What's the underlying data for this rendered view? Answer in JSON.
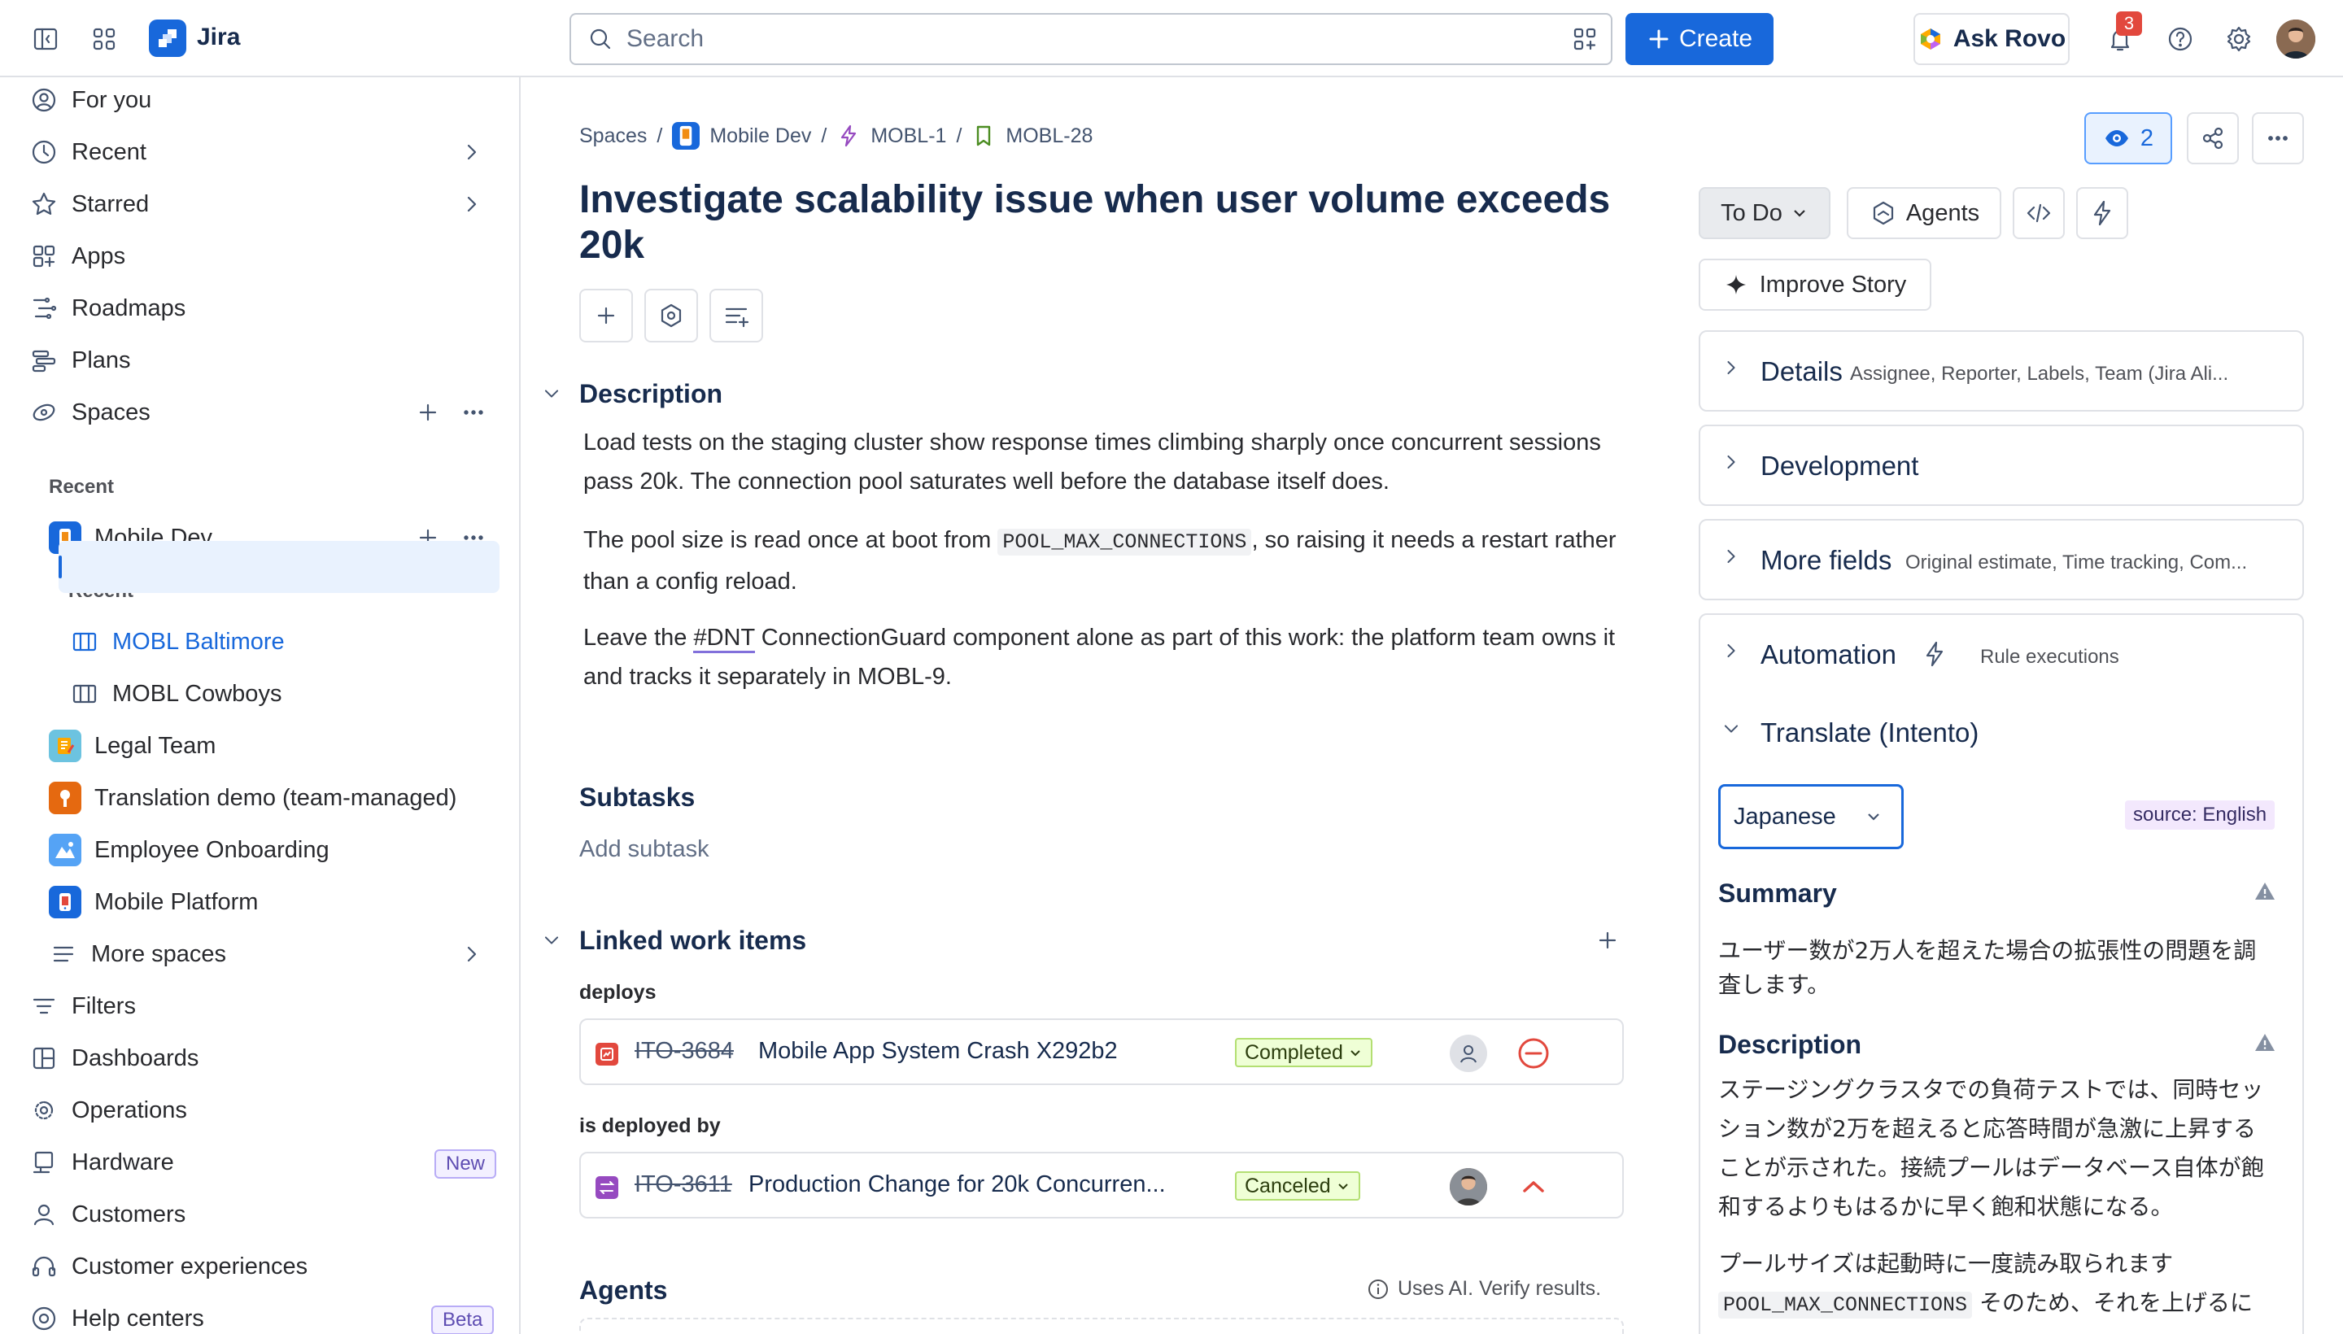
{
  "topbar": {
    "app_name": "Jira",
    "search_placeholder": "Search",
    "create_label": "Create",
    "ask_rovo_label": "Ask Rovo",
    "notification_count": "3"
  },
  "sidebar": {
    "for_you": "For you",
    "recent": "Recent",
    "starred": "Starred",
    "apps": "Apps",
    "roadmaps": "Roadmaps",
    "plans": "Plans",
    "spaces": "Spaces",
    "spaces_recent_heading": "Recent",
    "mobile_dev": "Mobile Dev",
    "mobile_dev_recent_heading": "Recent",
    "mobl_baltimore": "MOBL Baltimore",
    "mobl_cowboys": "MOBL Cowboys",
    "legal_team": "Legal Team",
    "translation_demo": "Translation demo (team-managed)",
    "employee_onboarding": "Employee Onboarding",
    "mobile_platform": "Mobile Platform",
    "more_spaces": "More spaces",
    "filters": "Filters",
    "dashboards": "Dashboards",
    "operations": "Operations",
    "hardware": "Hardware",
    "hardware_badge": "New",
    "customers": "Customers",
    "customer_experiences": "Customer experiences",
    "help_centers": "Help centers",
    "help_centers_badge": "Beta"
  },
  "breadcrumb": {
    "spaces": "Spaces",
    "project": "Mobile Dev",
    "epic": "MOBL-1",
    "issue": "MOBL-28"
  },
  "issue": {
    "title": "Investigate scalability issue when user volume exceeds 20k",
    "description_heading": "Description",
    "para1": "Load tests on the staging cluster show response times climbing sharply once concurrent sessions pass 20k. The connection pool saturates well before the database itself does.",
    "para2_a": "The pool size is read once at boot from ",
    "para2_code": "POOL_MAX_CONNECTIONS",
    "para2_b": ", so raising it needs a restart rather than a config reload.",
    "para3_a": "Leave the ",
    "para3_tag": "#DNT",
    "para3_b": " ConnectionGuard component alone as part of this work: the platform team owns it and tracks it separately in MOBL-9.",
    "subtasks_heading": "Subtasks",
    "add_subtask": "Add subtask",
    "linked_heading": "Linked work items",
    "agents_heading": "Agents",
    "ai_notice": "Uses AI. Verify results."
  },
  "linked_items": [
    {
      "relation": "deploys",
      "key": "ITO-3684",
      "summary": "Mobile App System Crash X292b2",
      "status": "Completed"
    },
    {
      "relation": "is deployed by",
      "key": "ITO-3611",
      "summary": "Production Change for 20k Concurren...",
      "status": "Canceled"
    }
  ],
  "right_panel": {
    "watchers": "2",
    "status": "To Do",
    "agents": "Agents",
    "improve_story": "Improve Story",
    "details_title": "Details",
    "details_sub": "Assignee, Reporter, Labels, Team (Jira Ali...",
    "development_title": "Development",
    "more_fields_title": "More fields",
    "more_fields_sub": "Original estimate, Time tracking, Com...",
    "automation_title": "Automation",
    "automation_sub": "Rule executions",
    "translate_title": "Translate (Intento)",
    "language": "Japanese",
    "source_badge": "source: English",
    "summary_heading": "Summary",
    "summary_text": "ユーザー数が2万人を超えた場合の拡張性の問題を調査します。",
    "description_heading": "Description",
    "desc_p1": "ステージングクラスタでの負荷テストでは、同時セッション数が2万を超えると応答時間が急激に上昇することが示された。接続プールはデータベース自体が飽和するよりもはるかに早く飽和状態になる。",
    "desc_p2_a": "プールサイズは起動時に一度読み取られます",
    "desc_p2_code": "POOL_MAX_CONNECTIONS",
    "desc_p2_b": " そのため、それを上げるには"
  },
  "colors": {
    "brand_blue": "#1868db",
    "selected_bg": "#e9f2fe",
    "danger": "#e2483d",
    "status_done_bg": "#efffd6"
  }
}
